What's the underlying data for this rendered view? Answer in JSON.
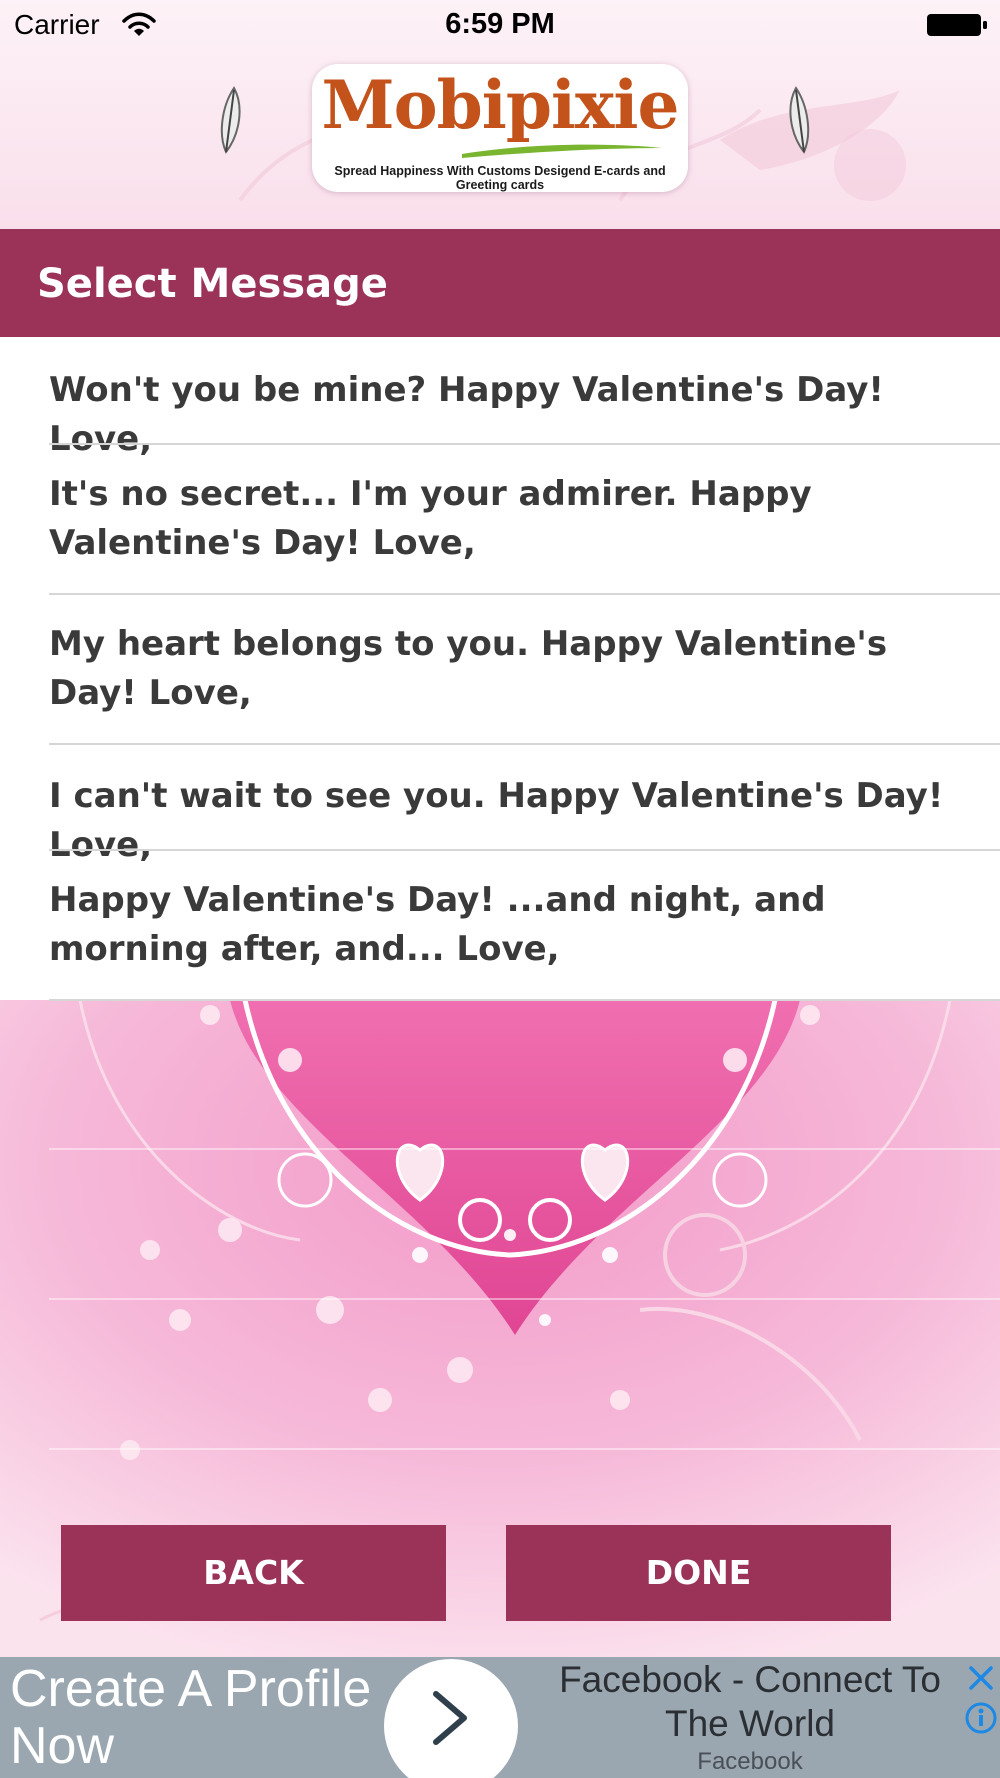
{
  "status_bar": {
    "carrier": "Carrier",
    "time": "6:59 PM"
  },
  "logo": {
    "word": "Mobipixie",
    "tagline": "Spread Happiness With Customs Desigend E-cards and Greeting cards"
  },
  "header": {
    "title": "Select Message"
  },
  "messages": [
    "Won't you be mine? Happy Valentine's Day! Love,",
    "It's no secret... I'm your admirer. Happy Valentine's Day! Love,",
    "My heart belongs to you. Happy Valentine's Day! Love,",
    "I can't wait to see you. Happy Valentine's Day! Love,",
    "Happy Valentine's Day! ...and night, and morning after, and... Love,"
  ],
  "buttons": {
    "back": "BACK",
    "done": "DONE"
  },
  "ad": {
    "headline": "Create A Profile Now",
    "title": "Facebook - Connect To The World",
    "source": "Facebook"
  },
  "colors": {
    "accent": "#9b3257",
    "background_pink": "#f3a9cf",
    "heart_pink": "#e8519a",
    "ad_background": "#9aa7b0"
  },
  "icons": [
    "wifi-icon",
    "battery-icon",
    "feather-icon",
    "chevron-right-icon",
    "close-icon",
    "info-icon"
  ]
}
